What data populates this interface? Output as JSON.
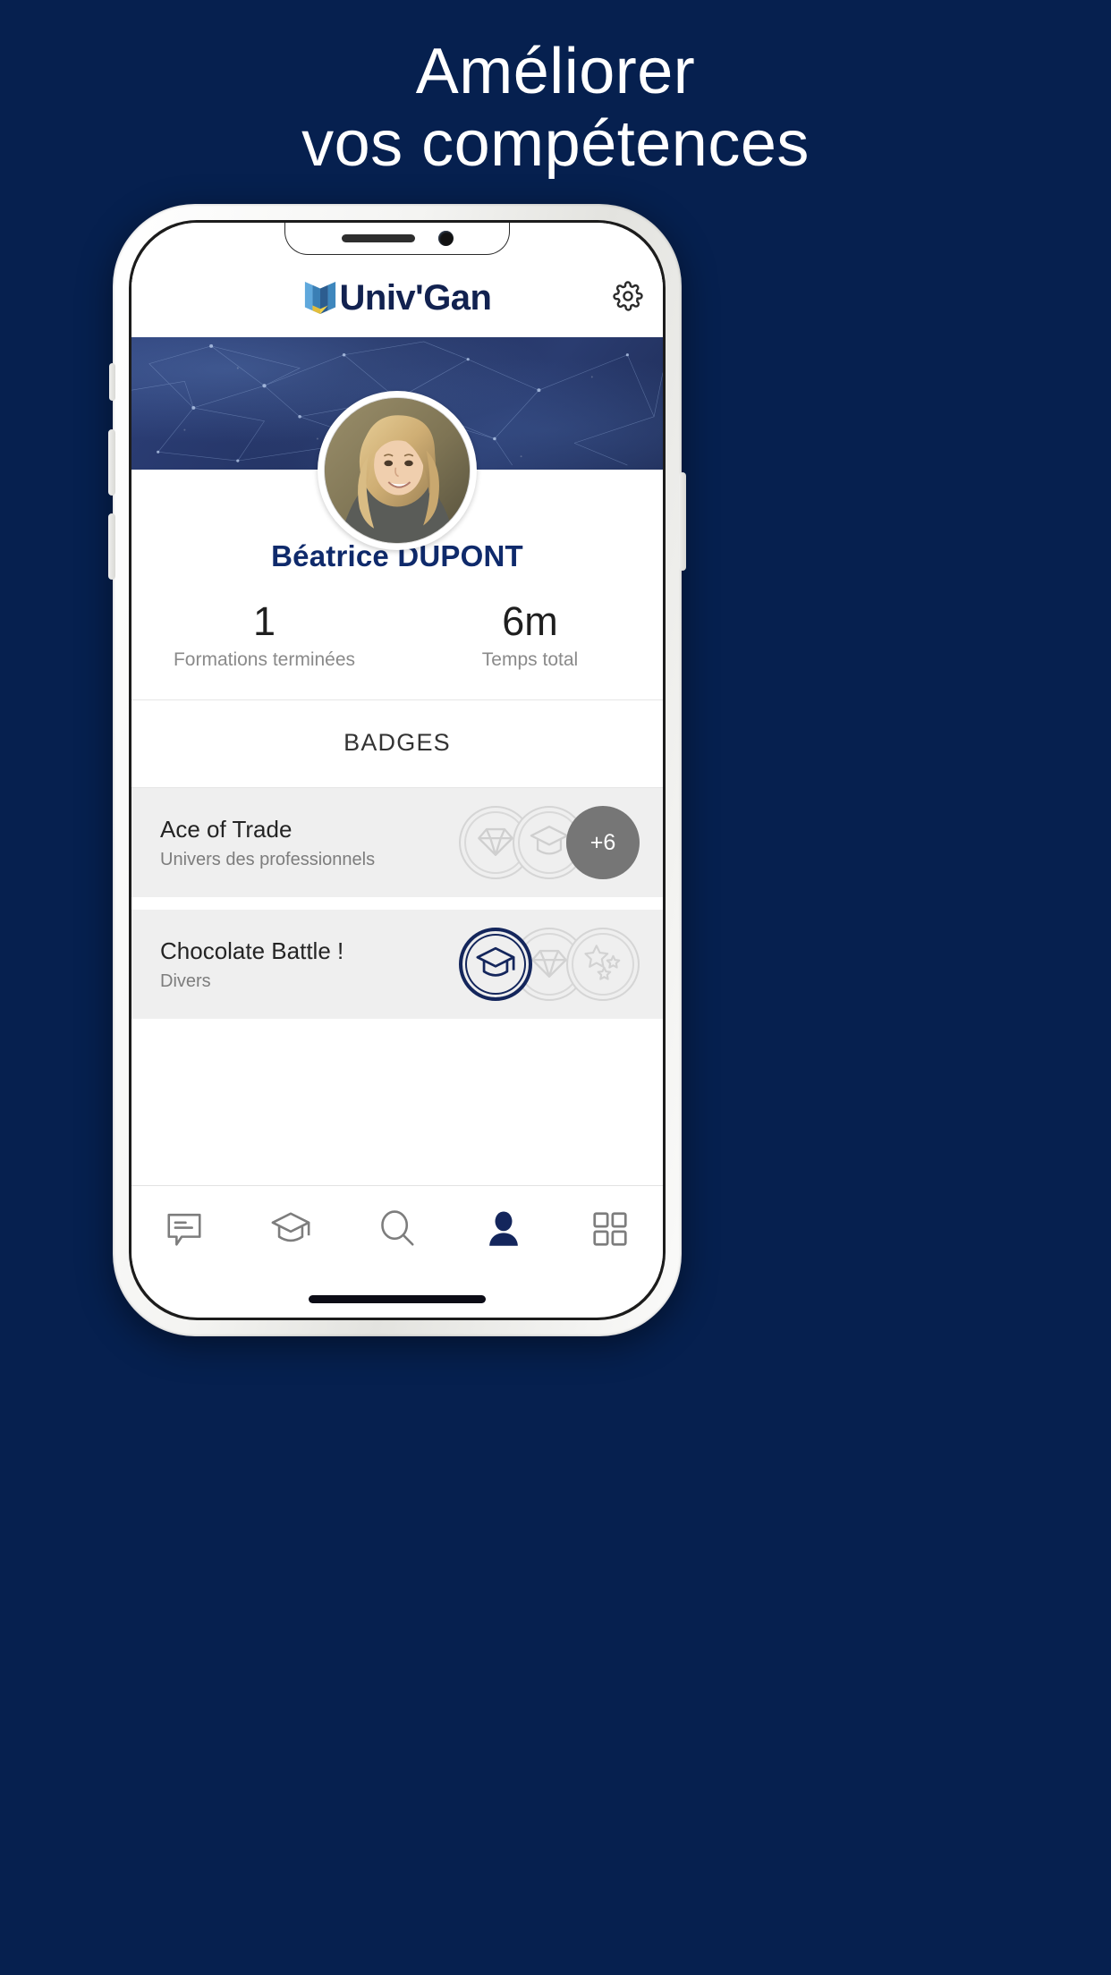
{
  "promo": {
    "headline_line1": "Améliorer",
    "headline_line2": "vos compétences",
    "background_color": "#06204f",
    "text_color": "#ffffff"
  },
  "app": {
    "brand": {
      "name": "Univ'Gan",
      "logo_icon": "open-book-icon",
      "text_color": "#122250",
      "accent_blue": "#4a9ad4",
      "accent_yellow": "#f2d24b"
    },
    "header": {
      "settings_icon": "gear-icon"
    },
    "banner": {
      "style": "low-poly-network-pattern",
      "color": "#2a3c70"
    },
    "profile": {
      "avatar_icon": "user-photo-avatar",
      "name": "Béatrice DUPONT",
      "name_color": "#0f2a6b",
      "stats": [
        {
          "value": "1",
          "label": "Formations terminées"
        },
        {
          "value": "6m",
          "label": "Temps total"
        }
      ]
    },
    "badges_section": {
      "title": "BADGES",
      "items": [
        {
          "name": "Ace of Trade",
          "category": "Univers des professionnels",
          "coins": [
            {
              "icon": "diamond-icon",
              "state": "locked"
            },
            {
              "icon": "graduation-cap-icon",
              "state": "locked"
            }
          ],
          "extra_count": "+6"
        },
        {
          "name": "Chocolate Battle !",
          "category": "Divers",
          "coins": [
            {
              "icon": "graduation-cap-icon",
              "state": "earned"
            },
            {
              "icon": "diamond-icon",
              "state": "locked"
            },
            {
              "icon": "stars-icon",
              "state": "locked"
            }
          ],
          "extra_count": ""
        }
      ]
    },
    "bottom_nav": [
      {
        "icon": "chat-bubble-icon",
        "active": false
      },
      {
        "icon": "graduation-cap-icon",
        "active": false
      },
      {
        "icon": "search-icon",
        "active": false
      },
      {
        "icon": "person-icon",
        "active": true
      },
      {
        "icon": "grid-icon",
        "active": false
      }
    ],
    "active_nav_color": "#14265c",
    "inactive_nav_color": "#7d7d7d"
  }
}
